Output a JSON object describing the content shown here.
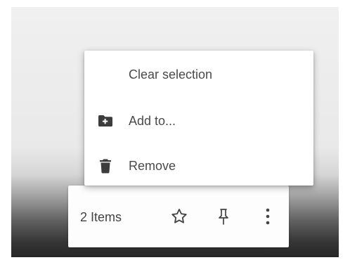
{
  "bottom_bar": {
    "count_label": "2 Items",
    "icons": [
      "star-outline-icon",
      "pin-icon",
      "more-vert-icon"
    ]
  },
  "menu": {
    "items": [
      {
        "label": "Clear selection",
        "icon": null
      },
      {
        "label": "Add to...",
        "icon": "folder-add-icon"
      },
      {
        "label": "Remove",
        "icon": "trash-icon"
      }
    ]
  },
  "colors": {
    "menu_background": "#ffffff",
    "text": "#4a4a4a",
    "icon": "#3c3c3c"
  }
}
